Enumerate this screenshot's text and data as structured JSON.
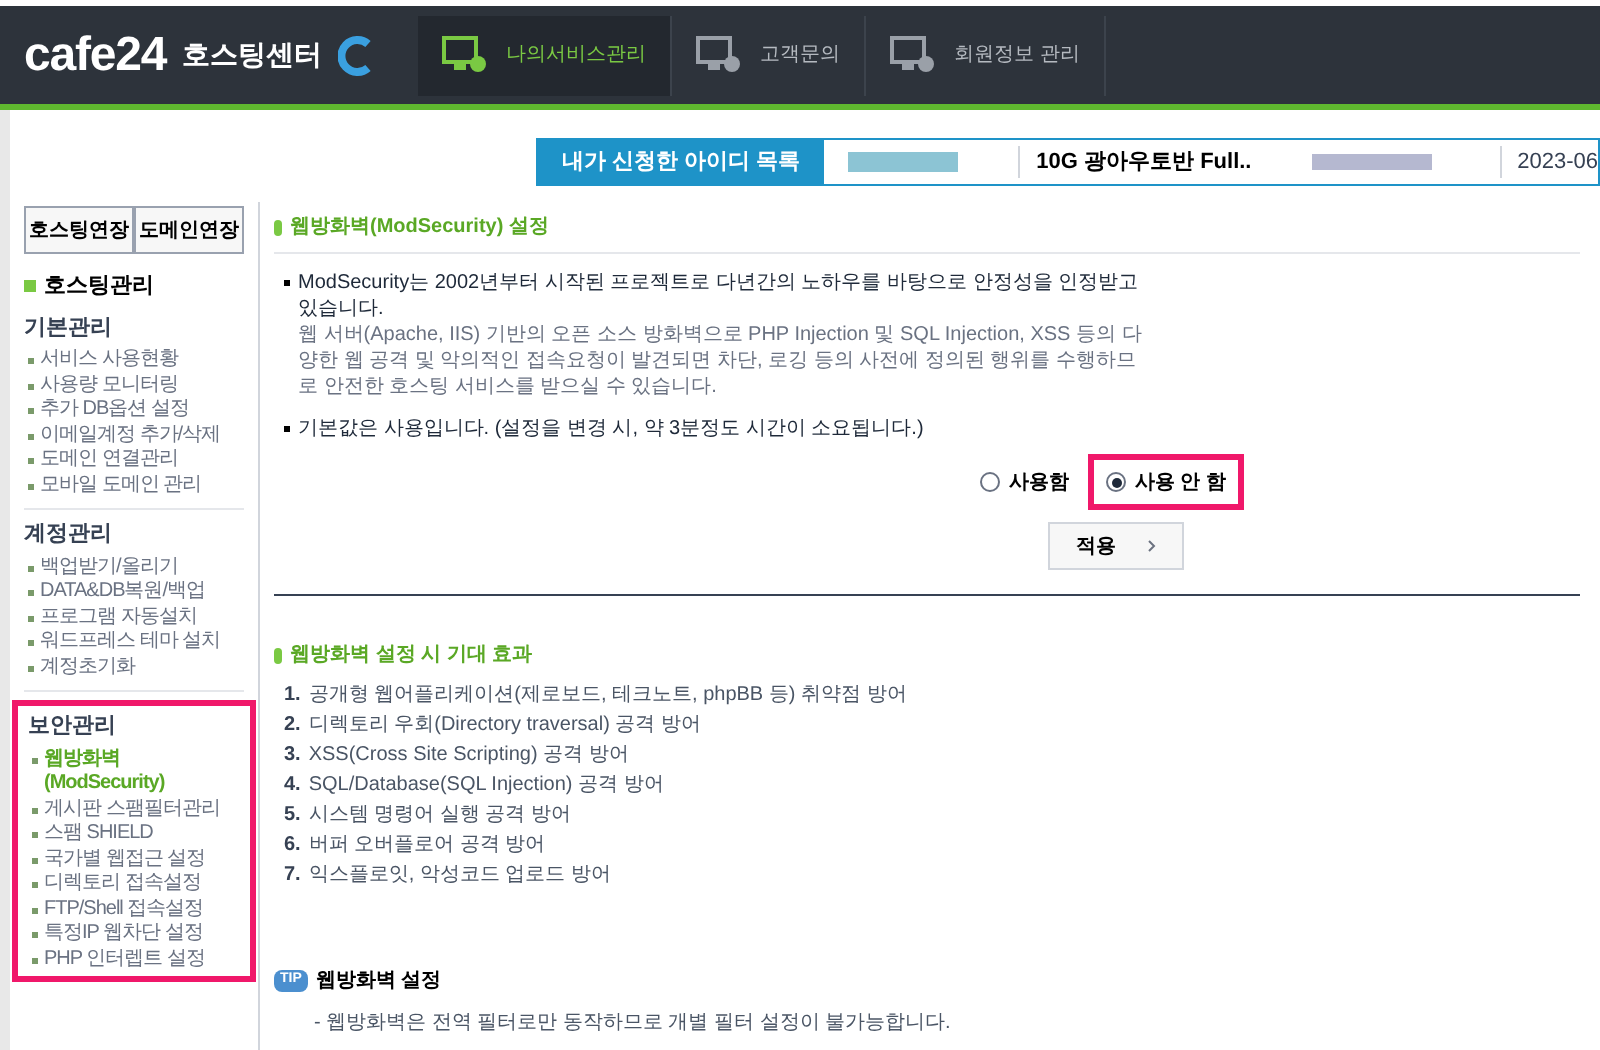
{
  "header": {
    "logo": "cafe24",
    "logo_subtitle": "호스팅센터",
    "nav": [
      {
        "label": "나의서비스관리",
        "selected": true
      },
      {
        "label": "고객문의",
        "selected": false
      },
      {
        "label": "회원정보 관리",
        "selected": false
      }
    ]
  },
  "account_bar": {
    "label": "내가 신청한 아이디 목록",
    "product": "10G 광아우토반 Full..",
    "date": "2023-06"
  },
  "sidebar": {
    "buttons": [
      "호스팅연장",
      "도메인연장"
    ],
    "title": "호스팅관리",
    "groups": [
      {
        "title": "기본관리",
        "highlighted": false,
        "items": [
          {
            "label": "서비스 사용현황",
            "selected": false
          },
          {
            "label": "사용량 모니터링",
            "selected": false
          },
          {
            "label": "추가 DB옵션 설정",
            "selected": false
          },
          {
            "label": "이메일계정 추가/삭제",
            "selected": false
          },
          {
            "label": "도메인 연결관리",
            "selected": false
          },
          {
            "label": "모바일 도메인 관리",
            "selected": false
          }
        ]
      },
      {
        "title": "계정관리",
        "highlighted": false,
        "items": [
          {
            "label": "백업받기/올리기",
            "selected": false
          },
          {
            "label": "DATA&DB복원/백업",
            "selected": false
          },
          {
            "label": "프로그램 자동설치",
            "selected": false
          },
          {
            "label": "워드프레스 테마 설치",
            "selected": false
          },
          {
            "label": "계정초기화",
            "selected": false
          }
        ]
      },
      {
        "title": "보안관리",
        "highlighted": true,
        "items": [
          {
            "label": "웹방화벽 (ModSecurity)",
            "selected": true
          },
          {
            "label": "게시판 스팸필터관리",
            "selected": false
          },
          {
            "label": "스팸 SHIELD",
            "selected": false
          },
          {
            "label": "국가별 웹접근 설정",
            "selected": false
          },
          {
            "label": "디렉토리 접속설정",
            "selected": false
          },
          {
            "label": "FTP/Shell 접속설정",
            "selected": false
          },
          {
            "label": "특정IP 웹차단 설정",
            "selected": false
          },
          {
            "label": "PHP 인터렙트 설정",
            "selected": false
          }
        ]
      }
    ]
  },
  "settings": {
    "title": "웹방화벽(ModSecurity) 설정",
    "notes": [
      {
        "lead": "ModSecurity는 2002년부터 시작된 프로젝트로 다년간의 노하우를 바탕으로 안정성을 인정받고 있습니다.",
        "detail": "웹 서버(Apache, IIS) 기반의 오픈 소스 방화벽으로 PHP Injection 및 SQL Injection, XSS 등의 다양한 웹 공격 및 악의적인 접속요청이 발견되면 차단, 로깅 등의 사전에 정의된 행위를 수행하므로 안전한 호스팅 서비스를 받으실 수 있습니다."
      },
      {
        "lead": "기본값은 사용입니다. (설정을 변경 시, 약 3분정도 시간이 소요됩니다.)"
      }
    ],
    "options": [
      {
        "label": "사용함",
        "selected": false,
        "highlighted": false
      },
      {
        "label": "사용 안 함",
        "selected": true,
        "highlighted": true
      }
    ],
    "apply": "적용"
  },
  "effects": {
    "title": "웹방화벽 설정 시 기대 효과",
    "items": [
      {
        "number": "1.",
        "text": "공개형 웹어플리케이션(제로보드, 테크노트, phpBB 등) 취약점 방어"
      },
      {
        "number": "2.",
        "text": "디렉토리 우회(Directory traversal) 공격 방어"
      },
      {
        "number": "3.",
        "text": "XSS(Cross Site Scripting) 공격 방어"
      },
      {
        "number": "4.",
        "text": "SQL/Database(SQL Injection) 공격 방어"
      },
      {
        "number": "5.",
        "text": "시스템 명령어 실행 공격 방어"
      },
      {
        "number": "6.",
        "text": "버퍼 오버플로어 공격 방어"
      },
      {
        "number": "7.",
        "text": "익스플로잇, 악성코드 업로드 방어"
      }
    ]
  },
  "tip": {
    "badge": "TIP",
    "title": "웹방화벽 설정",
    "items": [
      "- 웹방화벽은 전역 필터로만 동작하므로 개별 필터 설정이 불가능합니다."
    ]
  }
}
